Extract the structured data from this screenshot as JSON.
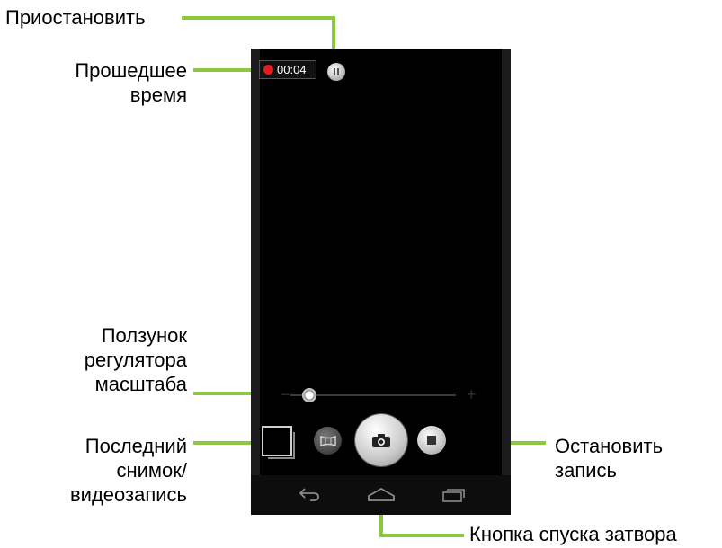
{
  "labels": {
    "pause": "Приостановить",
    "elapsed_line1": "Прошедшее",
    "elapsed_line2": "время",
    "zoom_line1": "Ползунок",
    "zoom_line2": "регулятора",
    "zoom_line3": "масштаба",
    "last_line1": "Последний",
    "last_line2": "снимок/",
    "last_line3": "видеозапись",
    "stop_line1": "Остановить",
    "stop_line2": "запись",
    "shutter": "Кнопка спуска затвора"
  },
  "screen": {
    "timer": "00:04",
    "zoom_minus": "−",
    "zoom_plus": "+"
  },
  "colors": {
    "callout_line": "#8dc63f",
    "record_dot": "#e51b23"
  },
  "icons": [
    "record-dot-icon",
    "pause-icon",
    "zoom-thumb",
    "last-photo-icon",
    "panorama-icon",
    "camera-icon",
    "stop-icon",
    "back-icon",
    "home-icon",
    "recents-icon"
  ]
}
